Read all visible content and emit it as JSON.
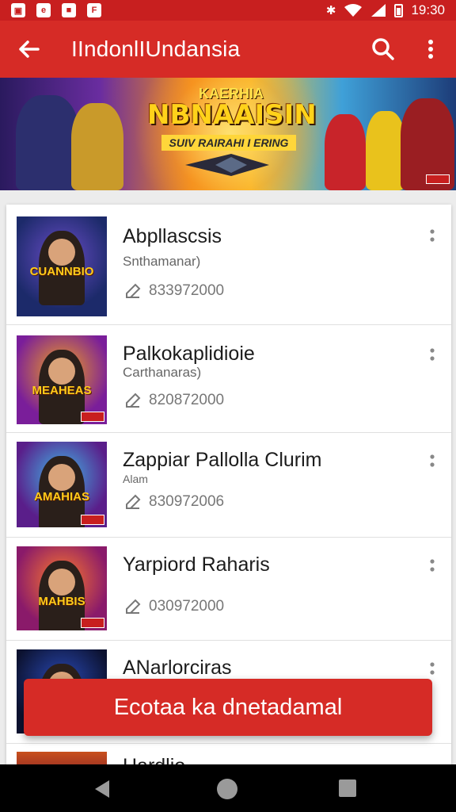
{
  "status_bar": {
    "time": "19:30",
    "left_icons": [
      "image-icon",
      "e-icon",
      "briefcase-icon",
      "f-icon"
    ],
    "right_icons": [
      "bluetooth-icon",
      "wifi-icon",
      "signal-icon",
      "battery-icon"
    ]
  },
  "app_bar": {
    "title": "IIndonlIUndansia",
    "color": "#d62b26"
  },
  "banner": {
    "title_top": "KAERHIA",
    "title": "NBNAAISIN",
    "subtitle": "SUIV RAIRAHI I ERING"
  },
  "items": [
    {
      "title": "Abpllascsis",
      "subtitle": "Snthamanar)",
      "meta": "833972000",
      "thumb_text": "CUANNBIO"
    },
    {
      "title": "Palkokaplidioie",
      "subtitle": "Carthanaras)",
      "meta": "820872000",
      "thumb_text": "MEAHEAS"
    },
    {
      "title": "Zappiar Pallolla Clurim",
      "subtitle": "Alam",
      "meta": "830972006",
      "thumb_text": "AMAHIAS"
    },
    {
      "title": "Yarpiord Raharis",
      "subtitle": "",
      "meta": "030972000",
      "thumb_text": "MAHBIS"
    },
    {
      "title": "ANarlorciras",
      "subtitle": "",
      "meta": "",
      "thumb_text": ""
    },
    {
      "title": "Hardlio",
      "subtitle": "",
      "meta": "",
      "thumb_text": ""
    }
  ],
  "fab": {
    "label": "Ecotaa ka dnetadamal"
  },
  "nav": {
    "icons": [
      "back-icon",
      "home-icon",
      "recent-apps-icon"
    ]
  }
}
